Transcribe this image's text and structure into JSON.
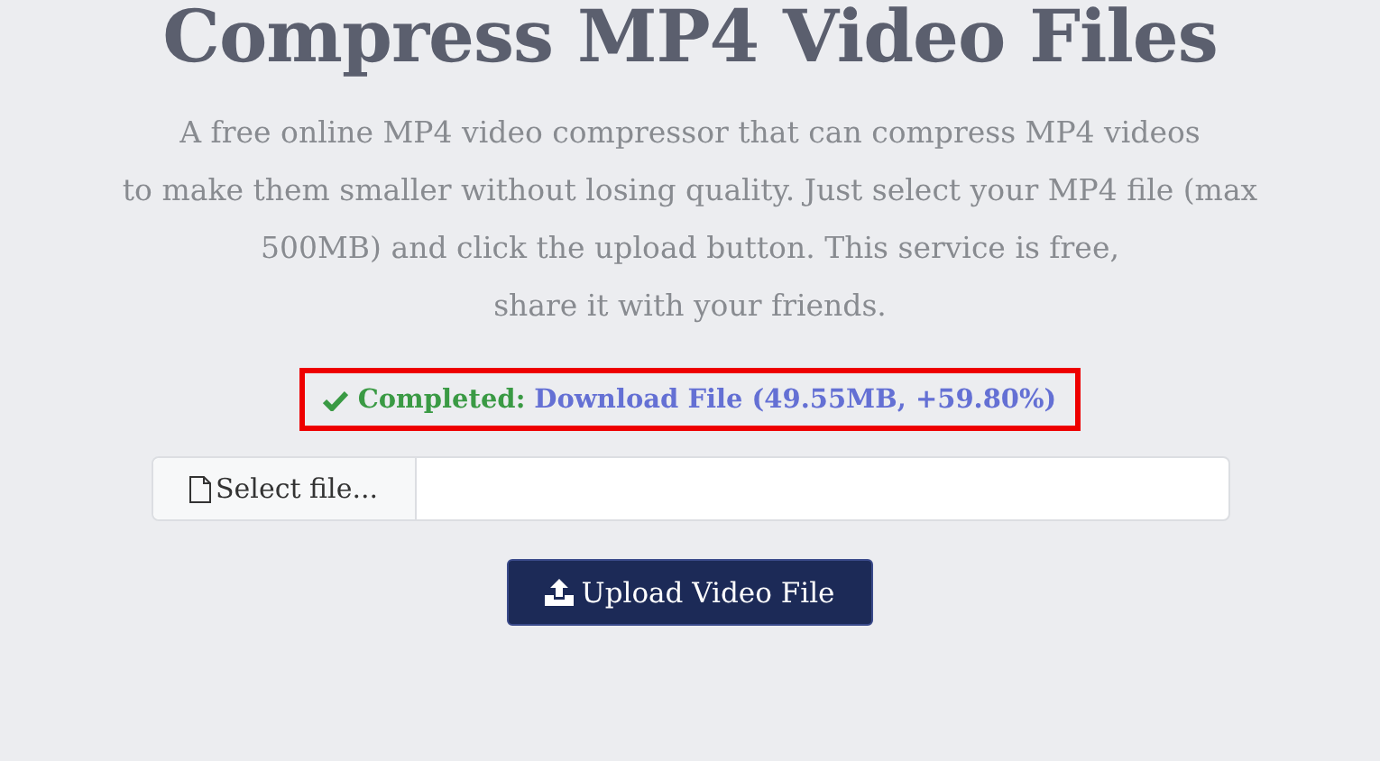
{
  "title": "Compress MP4 Video Files",
  "description_lines": [
    "A free online MP4 video compressor that can compress MP4 videos",
    "to make them smaller without losing quality. Just select your MP4 file (max",
    "500MB) and click the upload button. This service is free,",
    "share it with your friends."
  ],
  "status": {
    "label": "Completed:",
    "link": "Download File (49.55MB, +59.80%)"
  },
  "file_picker": {
    "button": "Select file..."
  },
  "upload_button": "Upload Video File"
}
